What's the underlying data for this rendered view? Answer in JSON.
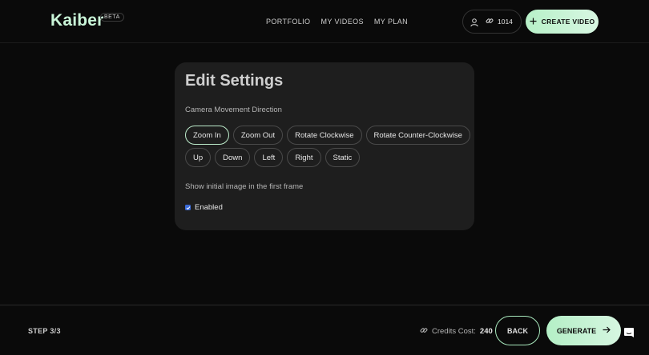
{
  "header": {
    "logo": "Kaiber",
    "badge": "BETA",
    "nav": [
      "PORTFOLIO",
      "MY VIDEOS",
      "MY PLAN"
    ],
    "credits": "1014",
    "create_label": "CREATE VIDEO"
  },
  "card": {
    "title": "Edit Settings",
    "movement_label": "Camera Movement Direction",
    "directions": [
      "Zoom In",
      "Zoom Out",
      "Rotate Clockwise",
      "Rotate Counter-Clockwise",
      "Up",
      "Down",
      "Left",
      "Right",
      "Static"
    ],
    "selected_direction": "Zoom In",
    "initial_frame_label": "Show initial image in the first frame",
    "enabled_label": "Enabled",
    "enabled_checked": true
  },
  "footer": {
    "step": "STEP 3/3",
    "cost_label": "Credits Cost:",
    "cost_value": "240",
    "back_label": "BACK",
    "generate_label": "GENERATE"
  },
  "icons": {
    "user": "user-icon",
    "credits": "link-icon",
    "create": "plus-icon",
    "generate": "arrow-right-icon",
    "chat": "chat-icon"
  },
  "colors": {
    "background": "#0a0a0a",
    "card": "#1e1e1e",
    "accent": "#b7f0c8",
    "checkbox": "#3a6ad8"
  }
}
